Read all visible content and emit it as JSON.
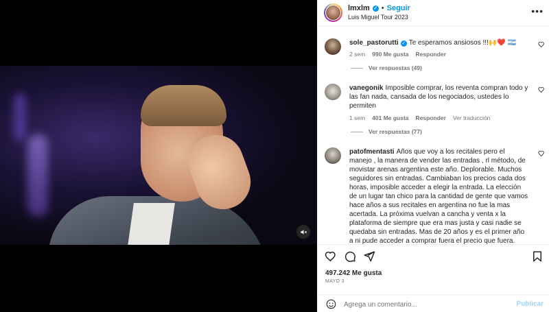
{
  "post": {
    "username": "lmxlm",
    "follow_label": "Seguir",
    "dot": "•",
    "subtitle": "Luis Miguel Tour 2023",
    "more": "•••"
  },
  "comments": [
    {
      "username": "sole_pastorutti",
      "verified": true,
      "text": "Te esperamos ansiosos !!!🙌❤️ 🇦🇷",
      "time": "2 sem",
      "likes": "990 Me gusta",
      "reply": "Responder",
      "translate": "",
      "replies": "Ver respuestas (49)"
    },
    {
      "username": "vanegonik",
      "verified": false,
      "text": "Imposible comprar, los reventa compran todo y las fan nada, cansada de los negociados, ustedes lo permiten",
      "time": "1 sem",
      "likes": "401 Me gusta",
      "reply": "Responder",
      "translate": "Ver traducción",
      "replies": "Ver respuestas (77)"
    },
    {
      "username": "patofmentasti",
      "verified": false,
      "text": "Años que voy a los recitales pero el manejo , la manera de vender las entradas , rl método, de movistar arenas argentina este año. Deplorable. Muchos seguidores sin entradas. Cambiaban los precios cada dos horas, imposible acceder a elegir la entrada. La elección de un lugar tan chico para la cantidad de gente que vamos hace años a sus recitales en argentina no fue la mas acertada. La próxima vuelvan a cancha y venta x la plataforma de siempre que era mas justa y casi nadie se quedaba sin entradas. Mas de 20 años y es el primer año a ni pude acceder a comprar fuera el precio que fuera. Muchas",
      "time": "",
      "likes": "",
      "reply": "",
      "translate": "",
      "replies": ""
    }
  ],
  "footer": {
    "likes_count": "497.242 Me gusta",
    "date": "MAYO 3",
    "comment_placeholder": "Agrega un comentario...",
    "publish_label": "Publicar"
  },
  "icons": {
    "like": "heart-icon",
    "comment": "comment-icon",
    "share": "send-icon",
    "save": "bookmark-icon",
    "emoji": "emoji-icon",
    "mute": "muted-speaker-icon"
  },
  "colors": {
    "accent": "#0095f6",
    "publish_disabled": "#a3d3fb",
    "muted_text": "#737373"
  }
}
